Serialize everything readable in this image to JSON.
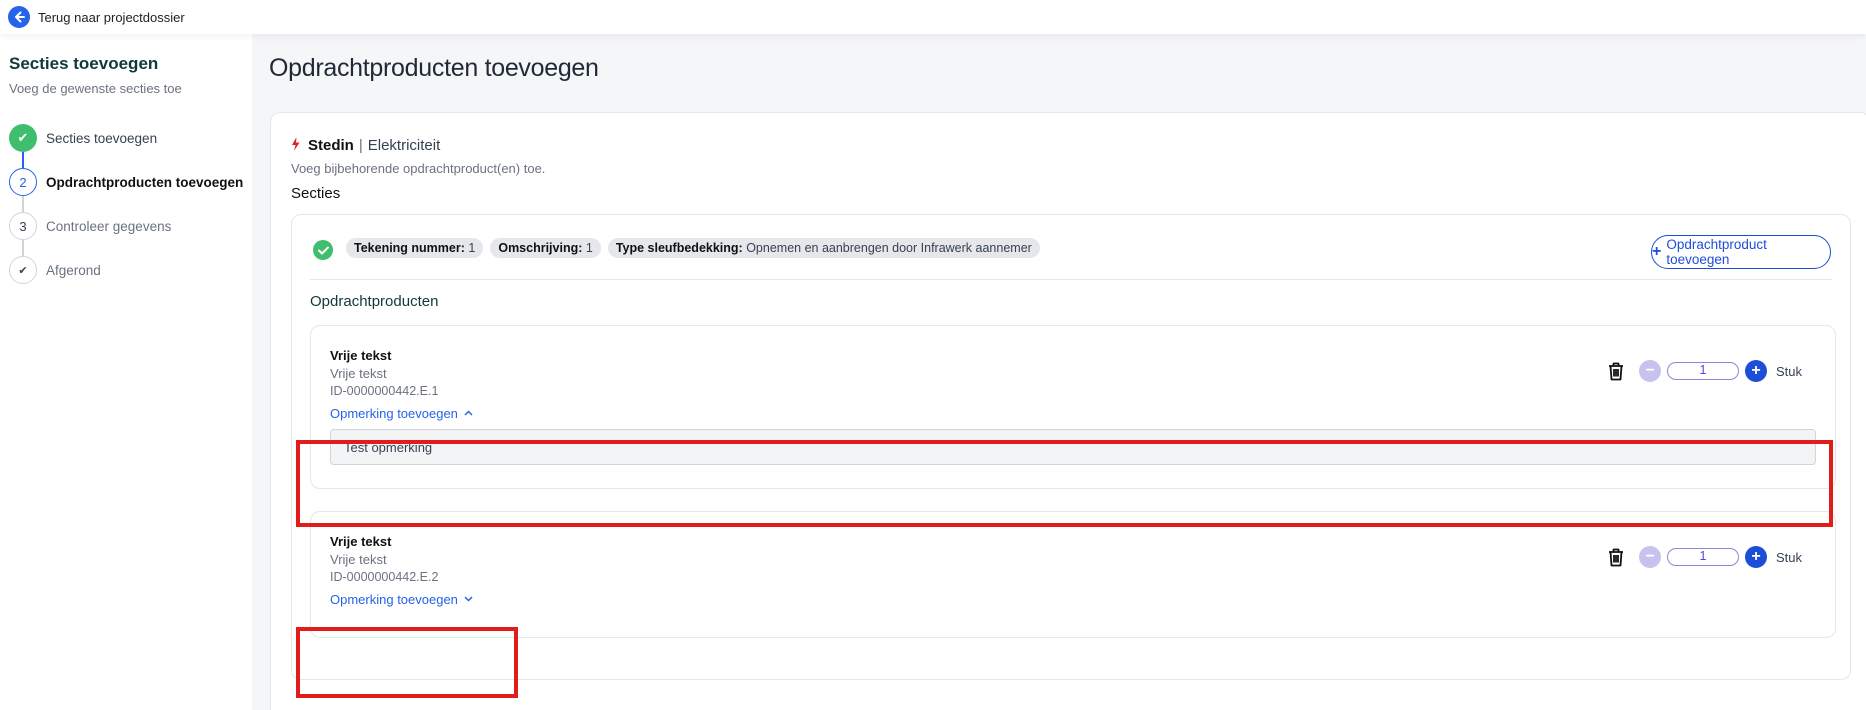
{
  "topbar": {
    "back_label": "Terug naar projectdossier"
  },
  "sidebar": {
    "title": "Secties toevoegen",
    "subtitle": "Voeg de gewenste secties toe",
    "steps": [
      {
        "marker": "✔",
        "label": "Secties toevoegen",
        "state": "done"
      },
      {
        "marker": "2",
        "label": "Opdrachtproducten toevoegen",
        "state": "active"
      },
      {
        "marker": "3",
        "label": "Controleer gegevens",
        "state": "todo"
      },
      {
        "marker": "✔",
        "label": "Afgerond",
        "state": "todo"
      }
    ]
  },
  "main": {
    "page_title": "Opdrachtproducten toevoegen",
    "provider": {
      "name": "Stedin",
      "separator": "|",
      "type": "Elektriciteit",
      "subtitle": "Voeg bijbehorende opdrachtproduct(en) toe."
    },
    "secties_heading": "Secties",
    "section": {
      "chips": [
        {
          "key": "Tekening nummer:",
          "value": "1"
        },
        {
          "key": "Omschrijving:",
          "value": "1"
        },
        {
          "key": "Type sleufbedekking:",
          "value": "Opnemen en aanbrengen door Infrawerk aannemer"
        }
      ],
      "add_button": "Opdrachtproduct toevoegen",
      "products_heading": "Opdrachtproducten",
      "products": [
        {
          "title": "Vrije tekst",
          "subtitle": "Vrije tekst",
          "id": "ID-0000000442.E.1",
          "remark_toggle": "Opmerking toevoegen",
          "remark_value": "Test opmerking",
          "quantity": "1",
          "unit": "Stuk"
        },
        {
          "title": "Vrije tekst",
          "subtitle": "Vrije tekst",
          "id": "ID-0000000442.E.2",
          "remark_toggle": "Opmerking toevoegen",
          "quantity": "1",
          "unit": "Stuk"
        }
      ]
    }
  },
  "colors": {
    "accent": "#2563eb",
    "success": "#3fbf6e",
    "highlight": "#e21b1b"
  }
}
